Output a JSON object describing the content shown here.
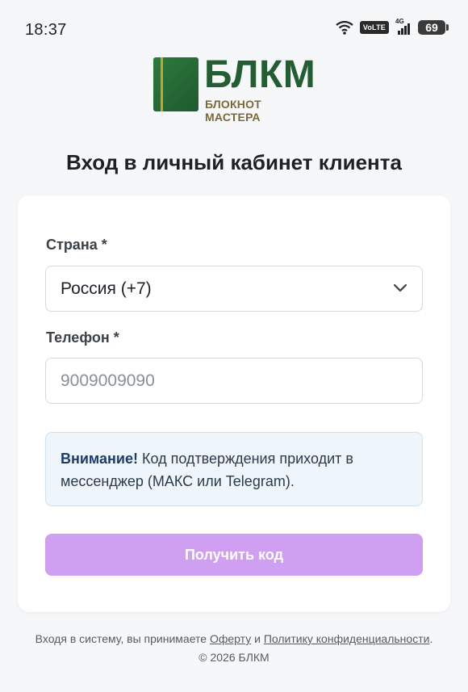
{
  "status_bar": {
    "time": "18:37",
    "volte": "VoLTE",
    "network": "4G",
    "battery": "69"
  },
  "logo": {
    "title": "БЛКМ",
    "subtitle": "БЛОКНОТ МАСТЕРА"
  },
  "page_title": "Вход в личный кабинет клиента",
  "form": {
    "country_label": "Страна *",
    "country_value": "Россия (+7)",
    "phone_label": "Телефон *",
    "phone_placeholder": "9009009090",
    "notice_strong": "Внимание!",
    "notice_text": " Код подтверждения приходит в мессенджер (МАКС или Telegram).",
    "submit_label": "Получить код"
  },
  "footer": {
    "prefix": "Входя в систему, вы принимаете ",
    "offer_link": "Оферту",
    "conjunction": " и ",
    "privacy_link": "Политику конфиденциальности",
    "suffix": ".",
    "copyright": "© 2026 БЛКМ"
  },
  "colors": {
    "brand_green": "#245d33",
    "button_bg": "#cfa0f2",
    "notice_bg": "#eef6fc"
  }
}
